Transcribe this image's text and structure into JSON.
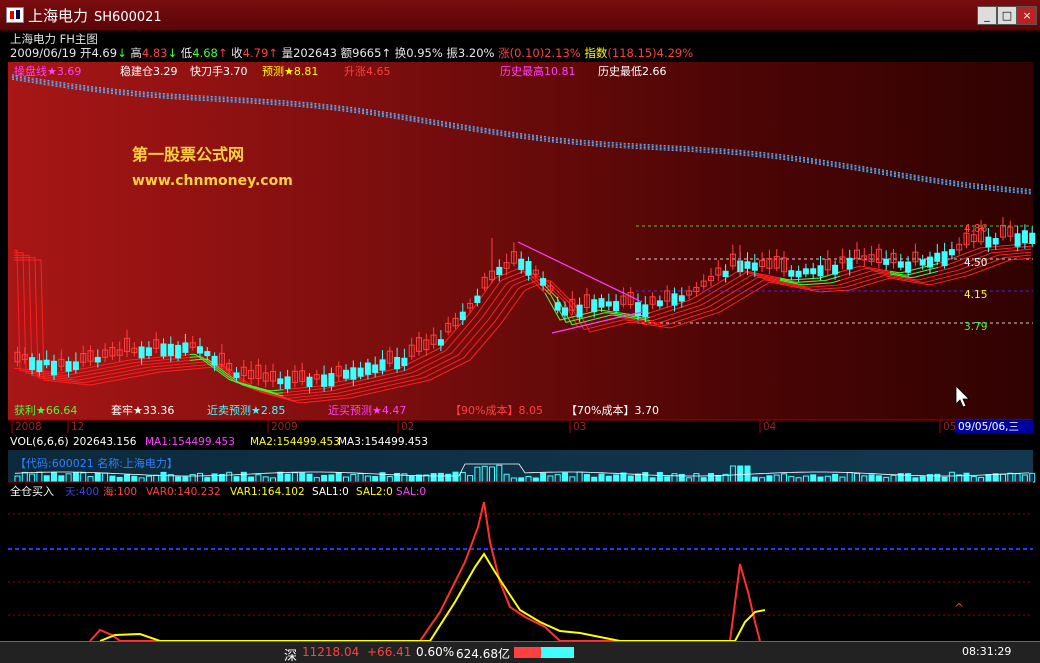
{
  "window": {
    "title": "上海电力",
    "code": "SH600021",
    "controls": [
      "_",
      "□",
      "×"
    ]
  },
  "info": {
    "chart_title": "上海电力 FH主图",
    "date": "2009/06/19",
    "open_label": "开",
    "open": "4.69",
    "high_label": "高",
    "high": "4.83",
    "low_label": "低",
    "low": "4.68",
    "close_label": "收",
    "close": "4.79",
    "volume_label": "量",
    "volume": "202643",
    "amount_label": "额",
    "amount": "9665",
    "turnover_label": "换",
    "turnover": "0.95%",
    "amplitude_label": "振",
    "amplitude": "3.20%",
    "change_label": "涨",
    "change": "(0.10)2.13%",
    "index_label": "指数",
    "index": "(118.15)4.29%"
  },
  "indicators_top": [
    {
      "label": "操盘线★3.69",
      "color": "#ff40ff"
    },
    {
      "label": "稳建仓3.29",
      "color": "#ffffff"
    },
    {
      "label": "快刀手3.70",
      "color": "#ffffff"
    },
    {
      "label": "预测★8.81",
      "color": "#ffff00"
    },
    {
      "label": "升涨4.65",
      "color": "#ff4040"
    },
    {
      "label": "历史最高10.81",
      "color": "#ff40ff"
    },
    {
      "label": "历史最低2.66",
      "color": "#ffffff"
    }
  ],
  "watermark": {
    "line1": "第一股票公式网",
    "line2": "www.chnmoney.com"
  },
  "level_labels": [
    {
      "value": "4.86",
      "color": "#ff4040"
    },
    {
      "value": "4.50",
      "color": "#ffffff"
    },
    {
      "value": "4.15",
      "color": "#ffff00"
    },
    {
      "value": "3.79",
      "color": "#40ff40"
    }
  ],
  "indicators_bottom": [
    {
      "label": "获利★66.64",
      "color": "#40ff40"
    },
    {
      "label": "套牢★33.36",
      "color": "#ffffff"
    },
    {
      "label": "近卖预测★2.85",
      "color": "#40ffff"
    },
    {
      "label": "近买预测★4.47",
      "color": "#ff40ff"
    },
    {
      "label": "【90%成本】8.05",
      "color": "#ff4040"
    },
    {
      "label": "【70%成本】3.70",
      "color": "#ffffff"
    }
  ],
  "time_axis": {
    "labels": [
      "2008",
      "12",
      "2009",
      "02",
      "03",
      "04",
      "05"
    ],
    "cursor_date": "09/05/06,三"
  },
  "volume_panel": {
    "label": "VOL(6,6,6)",
    "vol": "202643.156",
    "ma1": "MA1:154499.453",
    "ma2": "MA2:154499.453",
    "ma3": "MA3:154499.453",
    "stock_info": "【代码:600021 名称:上海电力】"
  },
  "indicator_panel": {
    "name": "全仓买入",
    "params": [
      {
        "label": "天:400",
        "color": "#4040ff"
      },
      {
        "label": "海:100",
        "color": "#ff4040"
      },
      {
        "label": "VAR0:140.232",
        "color": "#ff4040"
      },
      {
        "label": "VAR1:164.102",
        "color": "#ffff00"
      },
      {
        "label": "SAL1:0",
        "color": "#ffffff"
      },
      {
        "label": "SAL2:0",
        "color": "#ffff00"
      },
      {
        "label": "SAL:0",
        "color": "#ff40ff"
      }
    ]
  },
  "status_bar": {
    "market": "深",
    "index_value": "11218.04",
    "index_change": "+66.41",
    "index_pct": "0.60%",
    "turnover": "624.68亿",
    "time": "08:31:29"
  },
  "colors": {
    "up": "#ff4040",
    "down": "#40ffff",
    "ma_red": "#ff2020",
    "ma_green": "#30ff30",
    "upper_line": "#40a0ff"
  }
}
